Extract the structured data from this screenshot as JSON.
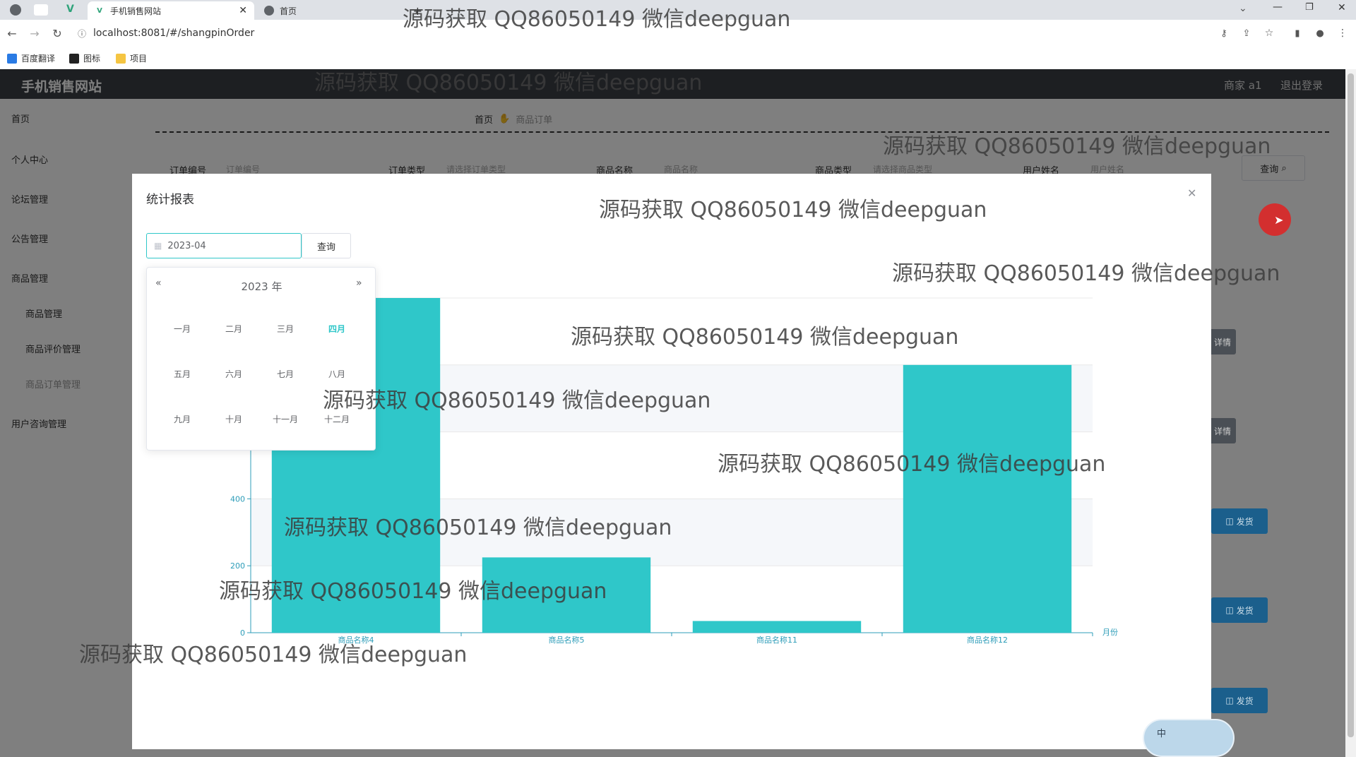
{
  "browser": {
    "tabs": [
      {
        "label": "手机销售网站",
        "active": true
      },
      {
        "label": "首页",
        "active": false
      }
    ],
    "address": "localhost:8081/#/shangpinOrder",
    "bookmarks": [
      "百度翻译",
      "图标",
      "项目"
    ]
  },
  "app": {
    "site_title": "手机销售网站",
    "user_label": "商家 a1",
    "logout": "退出登录",
    "breadcrumb": {
      "home": "首页",
      "current": "商品订单"
    },
    "sidebar": {
      "items": [
        "首页",
        "个人中心",
        "论坛管理",
        "公告管理",
        "商品管理",
        "用户咨询管理"
      ],
      "sub_items": [
        "商品管理",
        "商品评价管理",
        "商品订单管理"
      ]
    },
    "filters": {
      "order_no_label": "订单编号",
      "order_no_placeholder": "订单编号",
      "order_type_label": "订单类型",
      "order_type_placeholder": "请选择订单类型",
      "product_name_label": "商品名称",
      "product_name_placeholder": "商品名称",
      "product_type_label": "商品类型",
      "product_type_placeholder": "请选择商品类型",
      "user_name_label": "用户姓名",
      "user_name_placeholder": "用户姓名",
      "search_button": "查询"
    },
    "row_buttons": {
      "detail": "详情",
      "ship": "发货"
    }
  },
  "modal": {
    "title": "统计报表",
    "date_value": "2023-04",
    "query_button": "查询",
    "picker": {
      "year_label": "2023 年",
      "months": [
        "一月",
        "二月",
        "三月",
        "四月",
        "五月",
        "六月",
        "七月",
        "八月",
        "九月",
        "十月",
        "十一月",
        "十二月"
      ],
      "selected_month": "四月"
    }
  },
  "chart_data": {
    "type": "bar",
    "categories": [
      "商品名称4",
      "商品名称5",
      "商品名称11",
      "商品名称12"
    ],
    "values": [
      1000,
      225,
      35,
      800
    ],
    "ylim": [
      0,
      1000
    ],
    "yticks": [
      0,
      200,
      400
    ],
    "xlabel": "月份",
    "color": "#2fc7c9"
  },
  "watermark": "源码获取 QQ86050149 微信deepguan",
  "ime_label": "中"
}
